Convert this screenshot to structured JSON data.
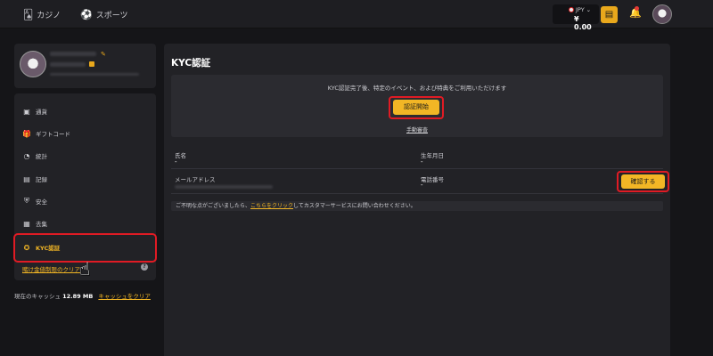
{
  "topbar": {
    "casino_label": "カジノ",
    "casino_icon": "casino-cards-icon",
    "sports_label": "スポーツ",
    "sports_icon": "sports-ball-icon",
    "currency": "JPY",
    "balance": "¥ 0.00",
    "wallet_icon": "wallet-icon",
    "bell_icon": "bell-icon"
  },
  "sidebar": {
    "items": [
      {
        "label": "通貨",
        "icon": "currency-icon"
      },
      {
        "label": "ギフトコード",
        "icon": "gift-icon"
      },
      {
        "label": "統計",
        "icon": "stats-icon"
      },
      {
        "label": "記録",
        "icon": "records-icon"
      },
      {
        "label": "安全",
        "icon": "shield-icon"
      },
      {
        "label": "去集",
        "icon": "collect-icon"
      },
      {
        "label": "KYC認証",
        "icon": "kyc-badge-icon"
      }
    ],
    "limit_link": "賭け金値制限のクリア",
    "cache_label": "現在のキャッシュ",
    "cache_size": "12.89 MB",
    "cache_clear": "キャッシュをクリア"
  },
  "main": {
    "title": "KYC認証",
    "kyc_message": "KYC認証完了後、特定のイベント、および特典をご利用いただけます",
    "start_button": "認証開始",
    "manual_link": "手動審査",
    "fields": {
      "name_label": "氏名",
      "name_value": "-",
      "dob_label": "生年月日",
      "dob_value": "-",
      "email_label": "メールアドレス",
      "phone_label": "電話番号",
      "phone_value": "-",
      "confirm_button": "確認する"
    },
    "notice_prefix": "ご不明な点がございましたら、",
    "notice_link": "こちらをクリック",
    "notice_suffix": "してカスタマーサービスにお問い合わせください。"
  }
}
